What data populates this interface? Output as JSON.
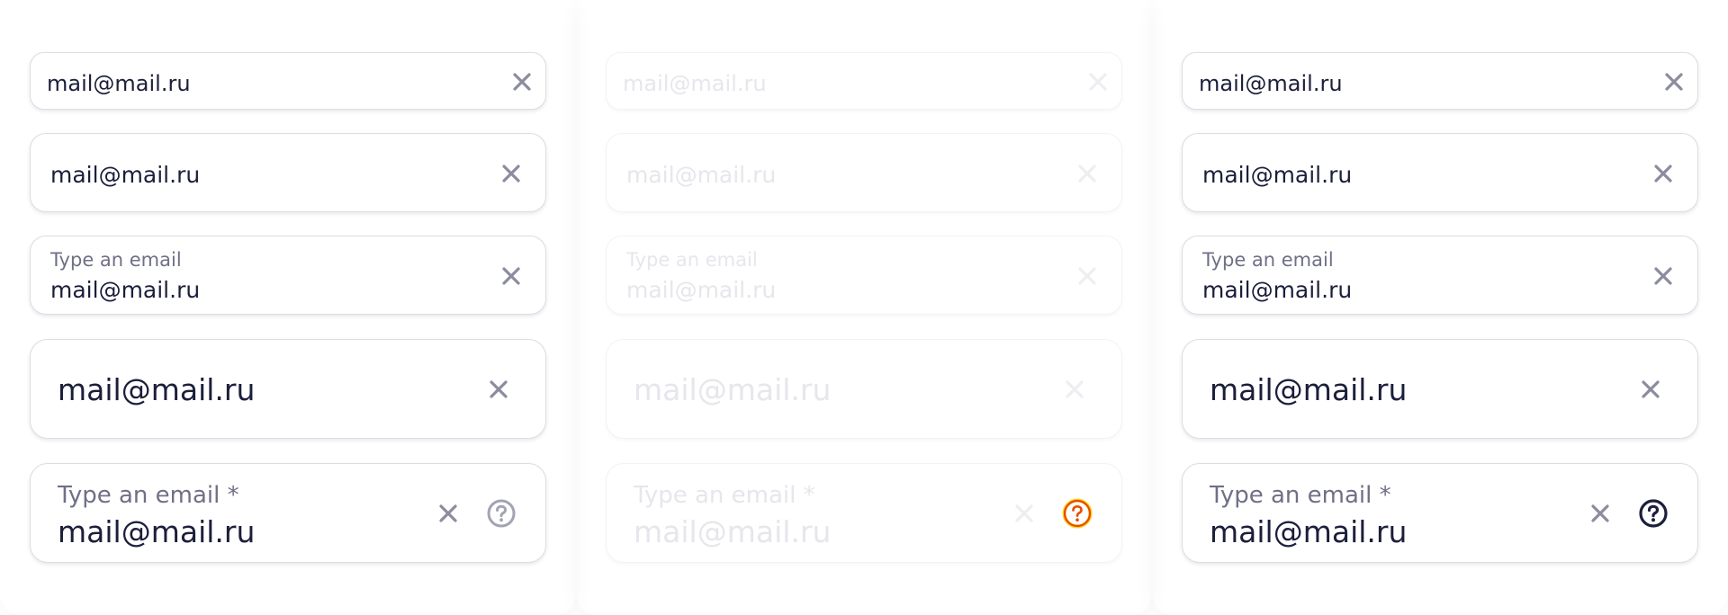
{
  "fields": {
    "value": "mail@mail.ru",
    "label": "Type an email",
    "label_required": "Type an email *"
  },
  "colors": {
    "text": "#1b1f3b",
    "label": "#6f7086",
    "clear_icon": "#8b8c9f",
    "help_icon_default": "#a2a3b3",
    "help_icon_disabled_focused": "#e84a00",
    "help_icon_disabled_focus_ring": "#ffd21e",
    "help_icon_hover": "#1b1f3b",
    "border": "#dcdde3"
  },
  "icons": {
    "clear": "close-icon",
    "help": "question-circle-icon"
  },
  "columns": [
    "default",
    "disabled",
    "hover"
  ]
}
